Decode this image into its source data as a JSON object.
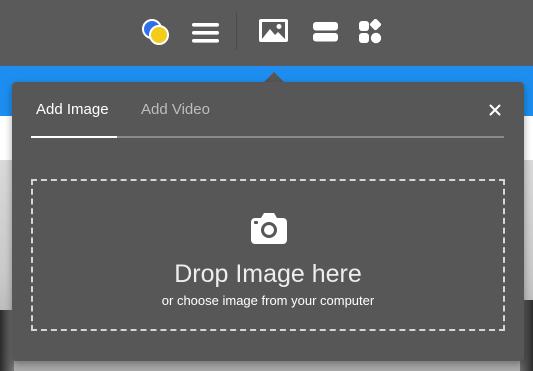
{
  "toolbar": {
    "items": [
      {
        "icon": "theme-colors-icon"
      },
      {
        "icon": "menu-icon"
      },
      {
        "icon": "image-icon"
      },
      {
        "icon": "rows-layout-icon"
      },
      {
        "icon": "widgets-icon"
      }
    ]
  },
  "panel": {
    "tabs": [
      {
        "label": "Add Image",
        "active": true
      },
      {
        "label": "Add Video",
        "active": false
      }
    ],
    "close_label": "×",
    "dropzone": {
      "icon": "camera-icon",
      "title": "Drop Image here",
      "subtitle": "or choose image from your computer"
    }
  },
  "colors": {
    "toolbar_bg": "#5a5a5a",
    "panel_bg": "#575757",
    "accent_blue": "#1d8ef0",
    "theme_blue": "#2f6fe8",
    "theme_yellow": "#f3cd1a"
  }
}
